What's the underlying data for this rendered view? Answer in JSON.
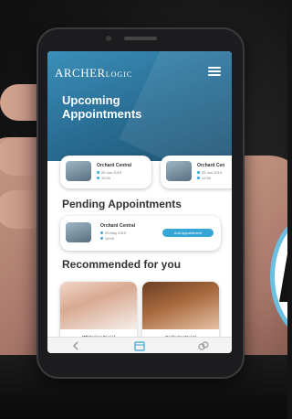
{
  "app": {
    "logo_main": "ARCHER",
    "logo_sub": "LOGIC"
  },
  "upcoming": {
    "title": "Upcoming Appointments",
    "cards": [
      {
        "title": "Orchard Central",
        "date": "25 Jan 2019",
        "time": "12:00"
      },
      {
        "title": "Orchard Cen",
        "date": "25 Jan 2019",
        "time": "12:00"
      }
    ]
  },
  "pending": {
    "title": "Pending Appointments",
    "card": {
      "title": "Orchard Central",
      "date": "25 May 2019",
      "time": "18:00",
      "action": "Add appointment"
    }
  },
  "recommended": {
    "title": "Recommended for you",
    "items": [
      {
        "title": "Whitening Facial",
        "sub": "$50"
      },
      {
        "title": "Scalp treatment",
        "sub": "$50"
      }
    ]
  },
  "colors": {
    "accent": "#36a6d6",
    "hero": "#2a6f96",
    "badge_ring": "#6bbfe0"
  },
  "icons": [
    "menu-icon",
    "back-chevron-icon",
    "calendar-icon",
    "link-icon"
  ]
}
